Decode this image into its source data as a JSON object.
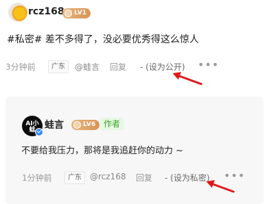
{
  "comment": {
    "username": "rcz168",
    "level_badge": "LV1",
    "text": "#私密# 差不多得了，没必要优秀得这么惊人",
    "time": "3分钟前",
    "region": "广东",
    "mention": "@蛙言",
    "reply_label": "回复",
    "visibility_action": "- (设为公开)",
    "more": "•••"
  },
  "reply": {
    "username": "蛙言",
    "avatar_text": "AI小蛙",
    "level_badge": "LV6",
    "author_tag": "作者",
    "text": "不要给我压力，那将是我追赶你的动力 ~",
    "time": "1分钟前",
    "region": "广东",
    "mention": "@rcz168",
    "reply_label": "回复",
    "visibility_action": "- (设为私密)",
    "more": "•••"
  },
  "colors": {
    "annotation_arrow": "#dd1a1a",
    "author_tag_green": "#3aa529",
    "level_badge_gold": "#d99455",
    "verified_blue": "#3a8cf4"
  },
  "icons": {
    "top_avatar": "duck-avatar-icon",
    "reply_avatar": "ai-frog-logo-avatar",
    "verified": "verified-check-icon",
    "more": "more-dots-icon"
  }
}
